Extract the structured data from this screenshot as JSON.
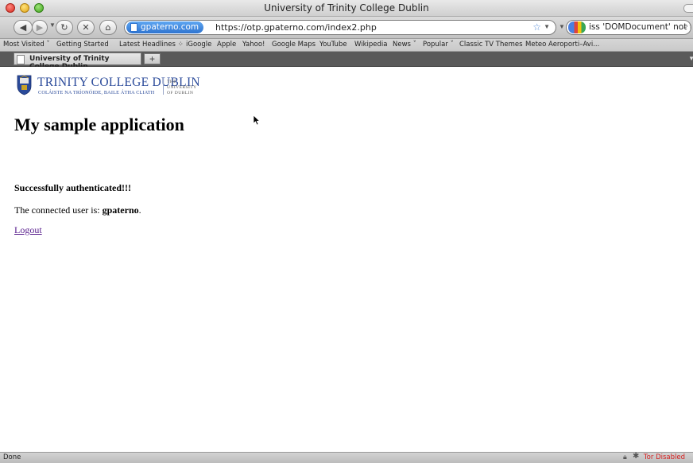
{
  "window": {
    "title": "University of Trinity College Dublin"
  },
  "toolbar": {
    "site_identity": "gpaterno.com",
    "url": "https://otp.gpaterno.com/index2.php",
    "search_value": "iss 'DOMDocument' not found"
  },
  "bookmarks": [
    "Most Visited ˇ",
    "Getting Started",
    "Latest Headlines ⁘",
    "iGoogle",
    "Apple",
    "Yahoo!",
    "Google Maps",
    "YouTube",
    "Wikipedia",
    "News ˇ",
    "Popular ˇ",
    "Classic TV Themes",
    "Meteo Aeroporti–Avi..."
  ],
  "tabs": [
    {
      "label": "University of Trinity College Dublin",
      "active": true
    }
  ],
  "page": {
    "logo": {
      "name": "TRINITY COLLEGE DUBLIN",
      "irish": "COLÁISTE NA TRÍONÓIDE, BAILE ÁTHA CLIATH",
      "univ_line1": "THE",
      "univ_line2": "UNIVERSITY",
      "univ_line3": "OF DUBLIN"
    },
    "title": "My sample application",
    "auth_message": "Successfully authenticated!!!",
    "connected_prefix": "The connected user is: ",
    "username": "gpaterno",
    "connected_suffix": ".",
    "logout": "Logout"
  },
  "status": {
    "text": "Done",
    "tor": "Tor Disabled"
  },
  "colors": {
    "link_visited": "#551a8b",
    "tcd_blue": "#2a4a9a",
    "tor_red": "#d62020"
  }
}
